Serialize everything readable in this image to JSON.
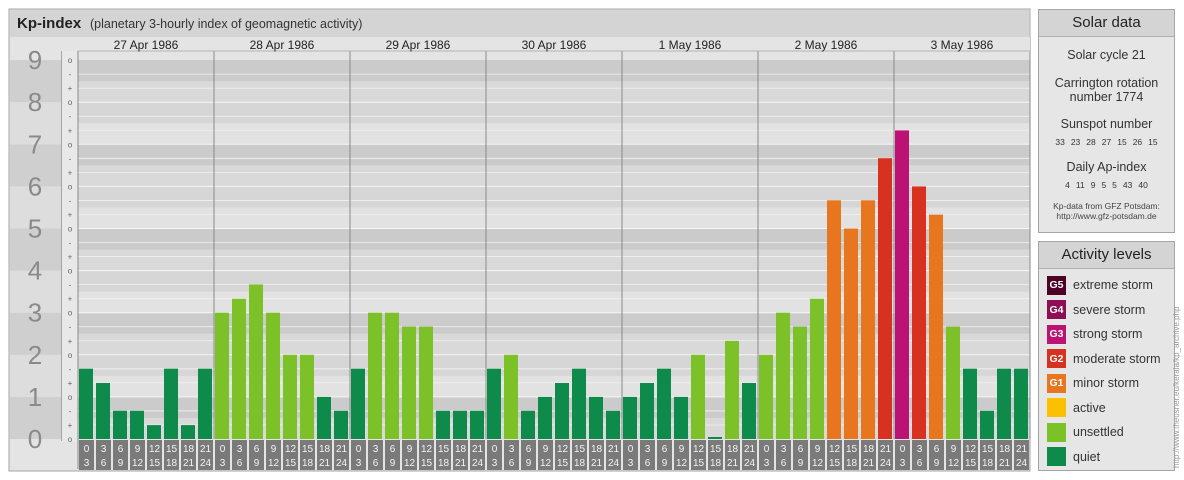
{
  "title": "Kp-index",
  "subtitle": "(planetary 3-hourly index of geomagnetic activity)",
  "chart_data": {
    "type": "bar",
    "title": "Kp-index",
    "subtitle": "(planetary 3-hourly index of geomagnetic activity)",
    "ylim": [
      0,
      9
    ],
    "y_ticks": [
      "0",
      "1",
      "2",
      "3",
      "4",
      "5",
      "6",
      "7",
      "8",
      "9"
    ],
    "minor_tick_labels": [
      "o",
      "+",
      "-"
    ],
    "days": [
      "27 Apr 1986",
      "28 Apr 1986",
      "29 Apr 1986",
      "30 Apr 1986",
      "1 May 1986",
      "2 May 1986",
      "3 May 1986"
    ],
    "interval_labels": [
      [
        "0",
        "3"
      ],
      [
        "3",
        "6"
      ],
      [
        "6",
        "9"
      ],
      [
        "9",
        "12"
      ],
      [
        "12",
        "15"
      ],
      [
        "15",
        "18"
      ],
      [
        "18",
        "21"
      ],
      [
        "21",
        "24"
      ]
    ],
    "values": [
      [
        1.67,
        1.33,
        0.67,
        0.67,
        0.33,
        1.67,
        0.33,
        1.67
      ],
      [
        3.0,
        3.33,
        3.67,
        3.0,
        2.0,
        2.0,
        1.0,
        0.67
      ],
      [
        1.67,
        3.0,
        3.0,
        2.67,
        2.67,
        0.67,
        0.67,
        0.67
      ],
      [
        1.67,
        2.0,
        0.67,
        1.0,
        1.33,
        1.67,
        1.0,
        0.67
      ],
      [
        1.0,
        1.33,
        1.67,
        1.0,
        2.0,
        0.0,
        2.33,
        1.33
      ],
      [
        2.0,
        3.0,
        2.67,
        3.33,
        5.67,
        5.0,
        5.67,
        6.67
      ],
      [
        7.33,
        6.0,
        5.33,
        2.67,
        1.67,
        0.67,
        1.67,
        1.67
      ]
    ],
    "level_colors": {
      "quiet": "#0e8a4a",
      "unsettled": "#7cc128",
      "active": "#fbc100",
      "G1": "#e8761f",
      "G2": "#d6321f",
      "G3": "#bb1273",
      "G4": "#8e0d55",
      "G5": "#4d0327"
    },
    "grid": true,
    "legend": "right"
  },
  "solar": {
    "title": "Solar data",
    "cycle": "Solar cycle 21",
    "carrington_line1": "Carrington rotation",
    "carrington_line2": "number 1774",
    "sunspot_title": "Sunspot number",
    "sunspot_values": [
      "33",
      "23",
      "28",
      "27",
      "15",
      "26",
      "15"
    ],
    "ap_title": "Daily Ap-index",
    "ap_values": [
      "4",
      "11",
      "9",
      "5",
      "5",
      "43",
      "40"
    ],
    "credit_line1": "Kp-data from GFZ Potsdam:",
    "credit_line2": "http://www.gfz-potsdam.de"
  },
  "activity": {
    "title": "Activity levels",
    "levels": [
      {
        "code": "G5",
        "label": "extreme storm",
        "color": "#4d0327"
      },
      {
        "code": "G4",
        "label": "severe storm",
        "color": "#8e0d55"
      },
      {
        "code": "G3",
        "label": "strong storm",
        "color": "#bb1273"
      },
      {
        "code": "G2",
        "label": "moderate storm",
        "color": "#d6321f"
      },
      {
        "code": "G1",
        "label": "minor storm",
        "color": "#e8761f"
      },
      {
        "code": "",
        "label": "active",
        "color": "#fbc100"
      },
      {
        "code": "",
        "label": "unsettled",
        "color": "#7cc128"
      },
      {
        "code": "",
        "label": "quiet",
        "color": "#0e8a4a"
      }
    ]
  },
  "side_credit": "http://www.theusner.eu/kerala/kp_archive.php"
}
